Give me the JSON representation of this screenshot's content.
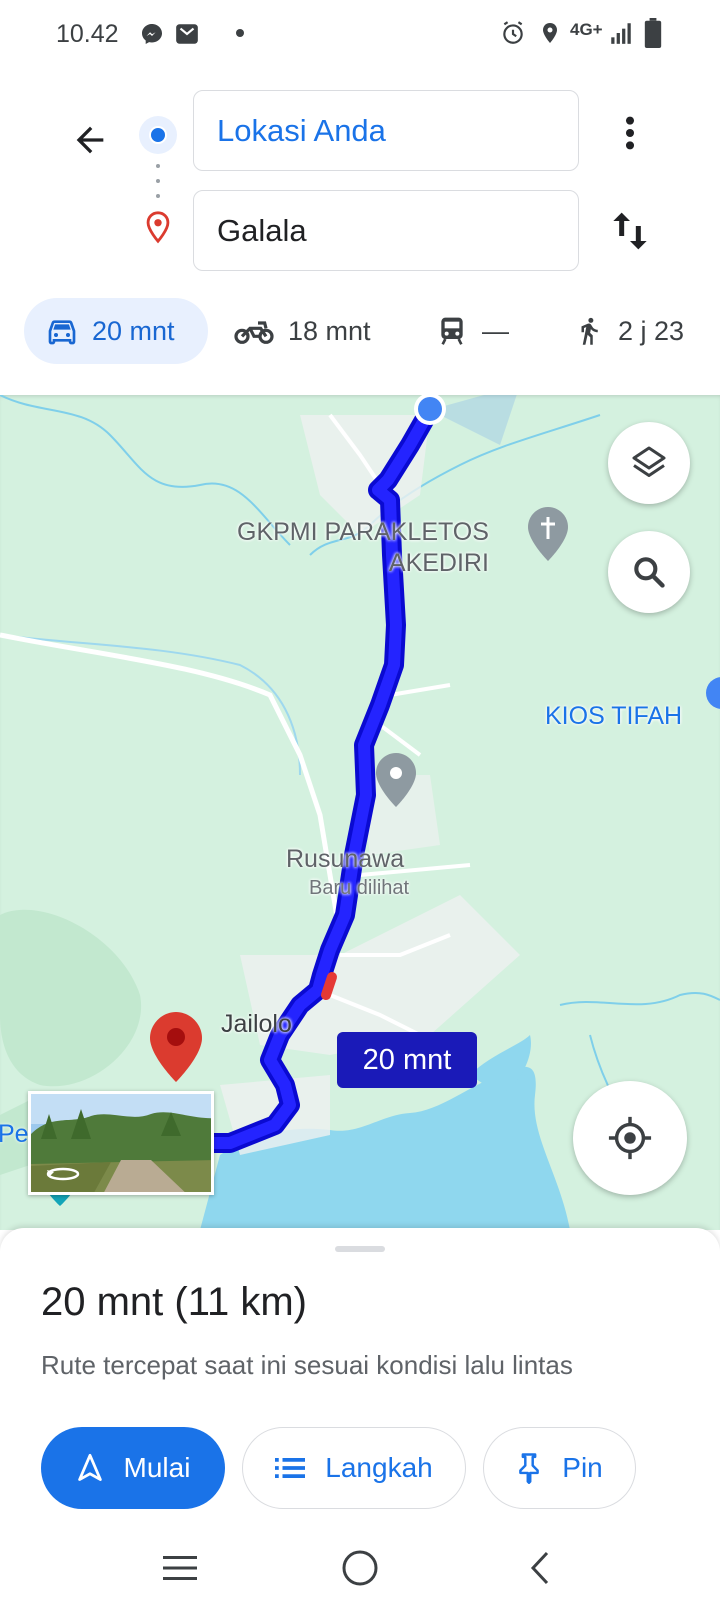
{
  "status_bar": {
    "time": "10.42",
    "network": "4G+",
    "icons": [
      "messenger-icon",
      "mail-icon",
      "notification-dot",
      "alarm-icon",
      "location-icon",
      "signal-icon",
      "battery-icon"
    ]
  },
  "directions": {
    "origin": "Lokasi Anda",
    "destination": "Galala"
  },
  "modes": [
    {
      "name": "car",
      "icon": "car-icon",
      "label": "20 mnt",
      "selected": true
    },
    {
      "name": "motorcycle",
      "icon": "motorcycle-icon",
      "label": "18 mnt",
      "selected": false
    },
    {
      "name": "transit",
      "icon": "train-icon",
      "label": "—",
      "selected": false
    },
    {
      "name": "walk",
      "icon": "walking-icon",
      "label": "2 j 23",
      "selected": false
    }
  ],
  "map": {
    "places": {
      "church": "GKPMI PARAKLETOS\nAKEDIRI",
      "kiosk": "KIOS TIFAH",
      "rusunawa": "Rusunawa",
      "rusunawa_sub": "Baru dilihat",
      "town": "Jailolo",
      "edge_label": "Pe"
    },
    "route_badge": "20 mnt"
  },
  "summary": {
    "title": "20 mnt (11 km)",
    "subtitle": "Rute tercepat saat ini sesuai kondisi lalu lintas",
    "start_label": "Mulai",
    "steps_label": "Langkah",
    "pin_label": "Pin"
  },
  "colors": {
    "accent": "#1a73e8",
    "route": "#1a1aff",
    "map_land": "#d4f1df",
    "water": "#8fd7ee",
    "destination": "#db3b2f"
  }
}
